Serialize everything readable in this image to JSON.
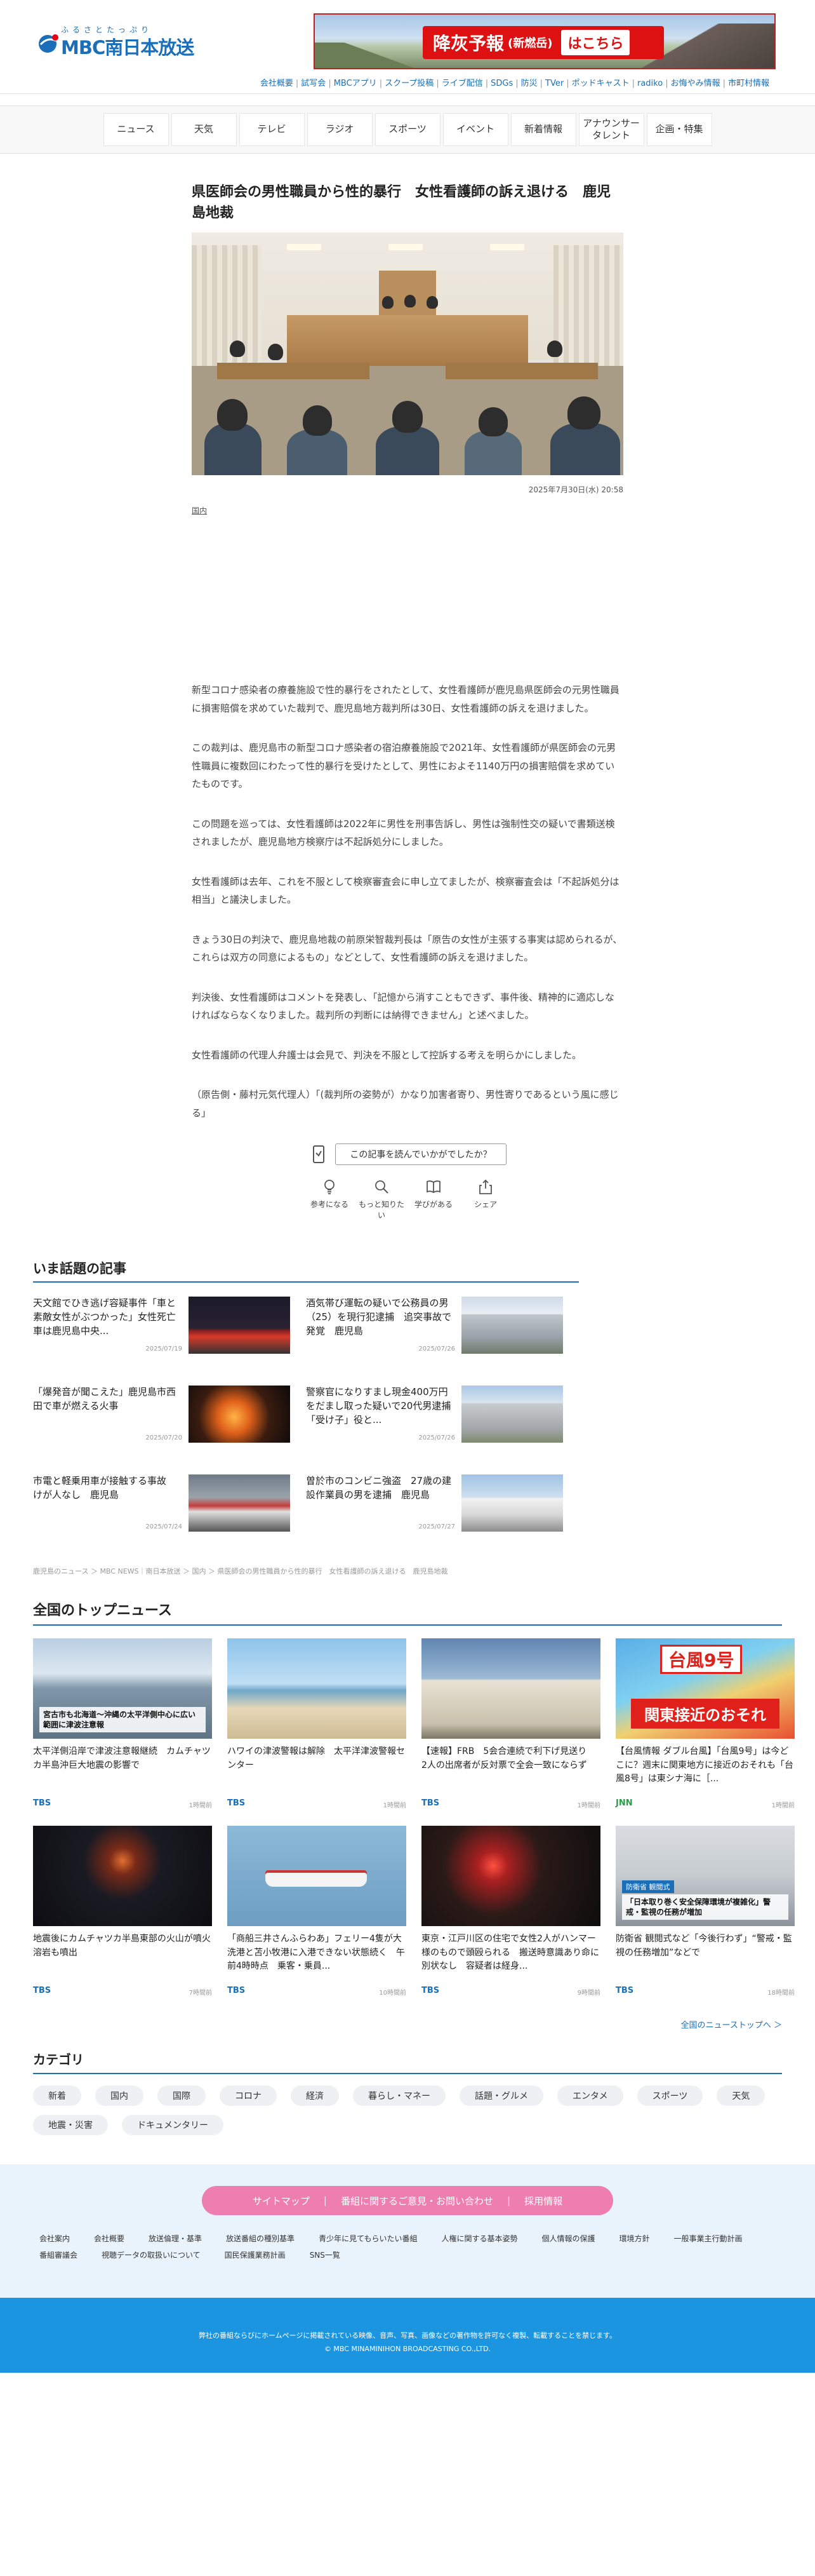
{
  "brand": {
    "kana": "ふるさとたっぷり",
    "name": "MBC南日本放送"
  },
  "ad": {
    "title": "降灰予報",
    "sub": "(新燃岳)",
    "cta": "はこちら"
  },
  "sublinks": [
    "会社概要",
    "試写会",
    "MBCアプリ",
    "スクープ投稿",
    "ライブ配信",
    "SDGs",
    "防災",
    "TVer",
    "ポッドキャスト",
    "radiko",
    "お悔やみ情報",
    "市町村情報"
  ],
  "nav": [
    "ニュース",
    "天気",
    "テレビ",
    "ラジオ",
    "スポーツ",
    "イベント",
    "新着情報",
    "アナウンサー\nタレント",
    "企画・特集"
  ],
  "article": {
    "title": "県医師会の男性職員から性的暴行　女性看護師の訴え退ける　鹿児島地裁",
    "date": "2025年7月30日(水) 20:58",
    "category": "国内",
    "paragraphs": [
      "新型コロナ感染者の療養施設で性的暴行をされたとして、女性看護師が鹿児島県医師会の元男性職員に損害賠償を求めていた裁判で、鹿児島地方裁判所は30日、女性看護師の訴えを退けました。",
      "この裁判は、鹿児島市の新型コロナ感染者の宿泊療養施設で2021年、女性看護師が県医師会の元男性職員に複数回にわたって性的暴行を受けたとして、男性におよそ1140万円の損害賠償を求めていたものです。",
      "この問題を巡っては、女性看護師は2022年に男性を刑事告訴し、男性は強制性交の疑いで書類送検されましたが、鹿児島地方検察庁は不起訴処分にしました。",
      "女性看護師は去年、これを不服として検察審査会に申し立てましたが、検察審査会は「不起訴処分は相当」と議決しました。",
      "きょう30日の判決で、鹿児島地裁の前原栄智裁判長は「原告の女性が主張する事実は認められるが、これらは双方の同意によるもの」などとして、女性看護師の訴えを退けました。",
      "判決後、女性看護師はコメントを発表し、「記憶から消すこともできず、事件後、精神的に適応しなければならなくなりました。裁判所の判断には納得できません」と述べました。",
      "女性看護師の代理人弁護士は会見で、判決を不服として控訴する考えを明らかにしました。",
      "（原告側・藤村元気代理人）「(裁判所の姿勢が）かなり加害者寄り、男性寄りであるという風に感じる」"
    ]
  },
  "feedback": {
    "question": "この記事を読んでいかがでしたか？",
    "reactions": [
      "参考になる",
      "もっと知りたい",
      "学びがある",
      "シェア"
    ]
  },
  "hot": {
    "title": "いま話題の記事",
    "items": [
      {
        "title": "天文館でひき逃げ容疑事件「車と素敵女性がぶつかった」女性死亡　車は鹿児島中央...",
        "date": "2025/07/19"
      },
      {
        "title": "酒気帯び運転の疑いで公務員の男（25）を現行犯逮捕　追突事故で発覚　鹿児島",
        "date": "2025/07/26"
      },
      {
        "title": "「爆発音が聞こえた」鹿児島市西田で車が燃える火事",
        "date": "2025/07/20"
      },
      {
        "title": "警察官になりすまし現金400万円をだまし取った疑いで20代男逮捕 「受け子」役と...",
        "date": "2025/07/26"
      },
      {
        "title": "市電と軽乗用車が接触する事故　けが人なし　鹿児島",
        "date": "2025/07/24"
      },
      {
        "title": "曽於市のコンビニ強盗　27歳の建設作業員の男を逮捕　鹿児島",
        "date": "2025/07/27"
      }
    ]
  },
  "breadcrumb": "鹿児島のニュース ＞ MBC NEWS｜南日本放送 ＞ 国内 ＞ 県医師会の男性職員から性的暴行　女性看護師の訴え退ける　鹿児島地裁",
  "top": {
    "title": "全国のトップニュース",
    "more": "全国のニューストップへ ＞",
    "items": [
      {
        "title": "太平洋側沿岸で津波注意報継続　カムチャツカ半島沖巨大地震の影響で",
        "src": "TBS",
        "ago": "1時間前",
        "cap": "宮古市も北海道〜沖縄の太平洋側中心に広い範囲に津波注意報"
      },
      {
        "title": "ハワイの津波警報は解除　太平洋津波警報センター",
        "src": "TBS",
        "ago": "1時間前",
        "cap": ""
      },
      {
        "title": "【速報】FRB　5会合連続で利下げ見送り　2人の出席者が反対票で全会一致にならず",
        "src": "TBS",
        "ago": "1時間前",
        "cap": ""
      },
      {
        "title": "【台風情報 ダブル台風】「台風9号」は今どこに？週末に関東地方に接近のおそれも「台風8号」は東シナ海に［...",
        "src": "JNN",
        "ago": "1時間前",
        "cap": "関東接近のおそれ",
        "badge": "台風9号"
      },
      {
        "title": "地震後にカムチャツカ半島東部の火山が噴火　溶岩も噴出",
        "src": "TBS",
        "ago": "7時間前",
        "cap": ""
      },
      {
        "title": "「商船三井さんふらわあ」フェリー4隻が大洗港と苫小牧港に入港できない状態続く　午前4時時点　乗客・乗員...",
        "src": "TBS",
        "ago": "10時間前",
        "cap": ""
      },
      {
        "title": "東京・江戸川区の住宅で女性2人がハンマー様のもので頭殴られる　搬送時意識あり命に別状なし　容疑者は経身...",
        "src": "TBS",
        "ago": "9時間前",
        "cap": ""
      },
      {
        "title": "防衛省 観閲式など「今後行わず」“警戒・監視の任務増加”などで",
        "src": "TBS",
        "ago": "18時間前",
        "cap": "「日本取り巻く安全保障環境が複雑化」警戒・監視の任務が増加",
        "badge2": "防衛省 観閲式"
      }
    ]
  },
  "categories": {
    "title": "カテゴリ",
    "items": [
      "新着",
      "国内",
      "国際",
      "コロナ",
      "経済",
      "暮らし・マネー",
      "話題・グルメ",
      "エンタメ",
      "スポーツ",
      "天気",
      "地震・災害",
      "ドキュメンタリー"
    ]
  },
  "footer": {
    "bar": [
      "サイトマップ",
      "番組に関するご意見・お問い合わせ",
      "採用情報"
    ],
    "links": [
      "会社案内",
      "会社概要",
      "放送倫理・基準",
      "放送番組の種別基準",
      "青少年に見てもらいたい番組",
      "人権に関する基本姿勢",
      "個人情報の保護",
      "環境方針",
      "一般事業主行動計画",
      "番組審議会",
      "視聴データの取扱いについて",
      "国民保護業務計画",
      "SNS一覧"
    ],
    "notice": "弊社の番組ならびにホームページに掲載されている映像、音声、写真、画像などの著作物を許可なく複製、転載することを禁じます。",
    "copyright": "© MBC MINAMINIHON BROADCASTING CO.,LTD."
  },
  "colors": {
    "brand": "#1a6fb8",
    "pink": "#ef7eb0",
    "footer": "#1b95e0",
    "adRed": "#d11"
  }
}
